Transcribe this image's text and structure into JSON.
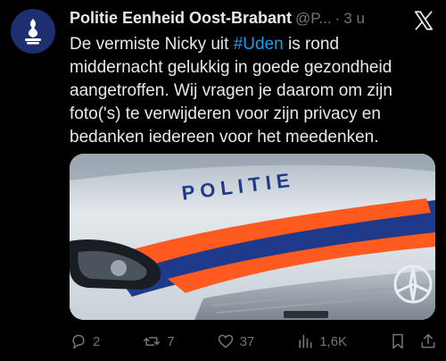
{
  "tweet": {
    "author_name": "Politie Eenheid Oost-Brabant",
    "handle": "@P...",
    "separator": "·",
    "time": "3 u",
    "text_before": "De vermiste Nicky uit ",
    "hashtag": "#Uden",
    "text_after": " is rond middernacht gelukkig in goede gezondheid aangetroffen. Wij vragen je daarom om zijn foto('s) te verwijderen voor zijn privacy en bedanken iedereen voor het meedenken."
  },
  "media": {
    "vehicle_text": "POLITIE",
    "colors": {
      "stripe_orange": "#ff5a1f",
      "stripe_blue": "#1f3a8a",
      "body": "#dfe5ea"
    }
  },
  "actions": {
    "replies": "2",
    "reposts": "7",
    "likes": "37",
    "views": "1,6K",
    "icons": [
      "reply-icon",
      "repost-icon",
      "like-icon",
      "views-icon",
      "bookmark-icon",
      "share-icon"
    ]
  },
  "colors": {
    "background": "#000000",
    "text": "#e7e9ea",
    "muted": "#71767b",
    "link": "#1d9bf0",
    "avatar": "#1d2f6f"
  }
}
